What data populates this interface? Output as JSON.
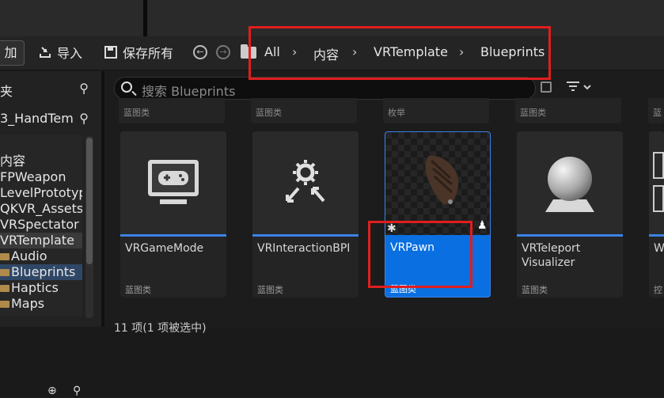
{
  "toolbar": {
    "add_label": "加",
    "import_label": "导入",
    "save_all_label": "保存所有",
    "breadcrumbs": [
      "All",
      "内容",
      "VRTemplate",
      "Blueprints"
    ]
  },
  "sidebar": {
    "header_label": "夹",
    "project_label": "3_HandTem",
    "tree": [
      {
        "label": "内容"
      },
      {
        "label": "FPWeapon"
      },
      {
        "label": "LevelPrototyp"
      },
      {
        "label": "QKVR_Assets"
      },
      {
        "label": "VRSpectator"
      },
      {
        "label": "VRTemplate"
      },
      {
        "label": "Audio"
      },
      {
        "label": "Blueprints"
      },
      {
        "label": "Haptics"
      },
      {
        "label": "Maps"
      }
    ]
  },
  "search": {
    "placeholder": "搜索 Blueprints"
  },
  "top_row_types": [
    "蓝图类",
    "蓝图类",
    "枚举",
    "蓝图类",
    "蓝"
  ],
  "assets": [
    {
      "name": "VRGameMode",
      "type": "蓝图类"
    },
    {
      "name": "VRInteractionBPI",
      "type": "蓝图类"
    },
    {
      "name": "VRPawn",
      "type": "蓝图类"
    },
    {
      "name": "VRTeleport Visualizer",
      "type": "蓝图类"
    },
    {
      "name": "W",
      "type": "控"
    }
  ],
  "status_text": "11 项(1 项被选中)",
  "colors": {
    "selection": "#0a6fe0",
    "annotation": "#e01e1e",
    "accent_bar": "#3b82e8"
  }
}
